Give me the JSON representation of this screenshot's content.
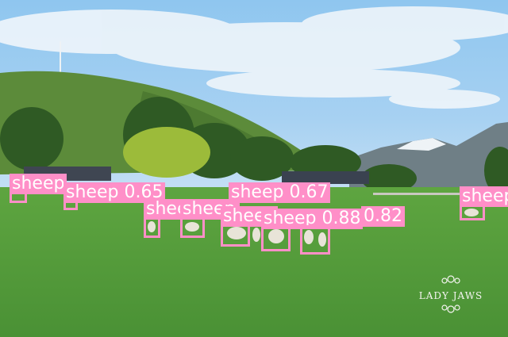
{
  "detections": [
    {
      "label": "sheep",
      "score": "",
      "show_score": false
    },
    {
      "label": "sheep",
      "score": "0.65",
      "show_score": true
    },
    {
      "label": "sheep",
      "score": "0.67",
      "show_score": true
    },
    {
      "label": "sheep",
      "score": "",
      "show_score": false
    },
    {
      "label": "sheep",
      "score": "",
      "show_score": false
    },
    {
      "label": "sheep",
      "score": "",
      "show_score": false
    },
    {
      "label": "sheep",
      "score": "0.88",
      "show_score": true
    },
    {
      "label": "sheep",
      "score": "0.82",
      "show_score": true
    },
    {
      "label": "sheep",
      "score": "",
      "show_score": false
    },
    {
      "label": "sheep",
      "score": "",
      "show_score": false
    }
  ],
  "watermark": {
    "text": "LADY JAWS"
  },
  "colors": {
    "box": "#ff8fc8",
    "label_text": "#ffffff",
    "grass": "#4f9a3a",
    "sky": "#8ec4ee"
  }
}
